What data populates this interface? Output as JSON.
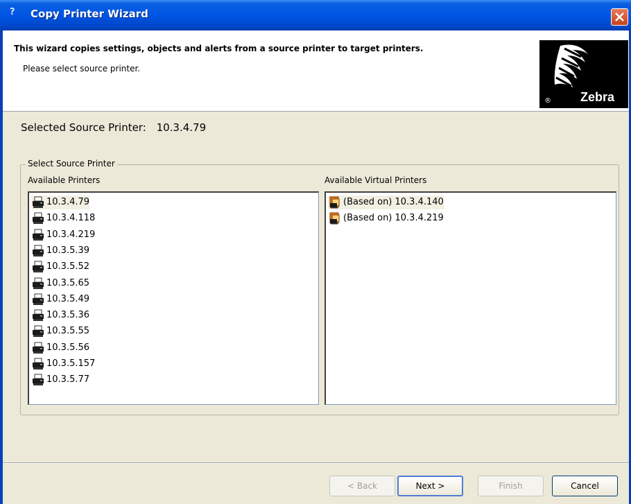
{
  "window": {
    "title": "Copy Printer Wizard",
    "title_icon": "?"
  },
  "header": {
    "title": "This wizard copies settings, objects and alerts from a source printer to target printers.",
    "subtitle": "Please select source printer.",
    "logo_text": "Zebra",
    "logo_reg": "®"
  },
  "selected": {
    "label": "Selected Source Printer:",
    "value": "10.3.4.79"
  },
  "group": {
    "legend": "Select Source Printer",
    "available_label": "Available Printers",
    "virtual_label": "Available Virtual Printers",
    "available_printers": [
      "10.3.4.79",
      "10.3.4.118",
      "10.3.4.219",
      "10.3.5.39",
      "10.3.5.52",
      "10.3.5.65",
      "10.3.5.49",
      "10.3.5.36",
      "10.3.5.55",
      "10.3.5.56",
      "10.3.5.157",
      "10.3.5.77"
    ],
    "virtual_printers": [
      "(Based on) 10.3.4.140",
      "(Based on) 10.3.4.219"
    ]
  },
  "buttons": {
    "back": "< Back",
    "next": "Next >",
    "finish": "Finish",
    "cancel": "Cancel"
  },
  "colors": {
    "titlebar": "#0055e5",
    "window_bg": "#ece9d8",
    "selection": "#f2efe3"
  }
}
